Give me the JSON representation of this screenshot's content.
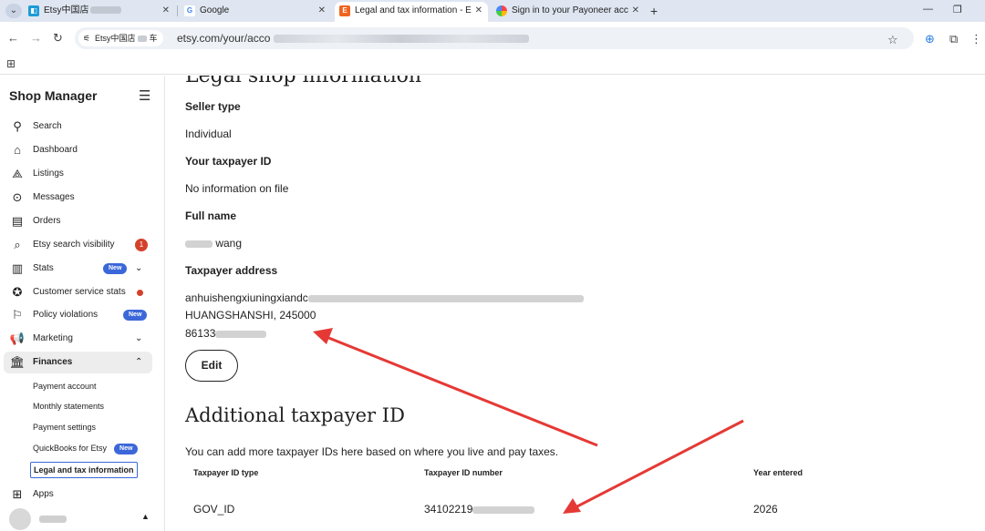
{
  "browser": {
    "tabs": [
      {
        "title": "Etsy中国店",
        "favicon": "etsy-sm-icon",
        "active": false
      },
      {
        "title": "Google",
        "favicon": "google-icon",
        "active": false
      },
      {
        "title": "Legal and tax information - E",
        "favicon": "etsy-icon",
        "active": true
      },
      {
        "title": "Sign in to your Payoneer acc",
        "favicon": "payoneer-icon",
        "active": false
      }
    ],
    "tab_close": "✕",
    "new_tab": "+",
    "site_chip": "Etsy中国店",
    "site_chip_tail": "车",
    "url": "etsy.com/your/acco"
  },
  "sidebar": {
    "title": "Shop Manager",
    "items": [
      {
        "label": "Search",
        "icon": "search-icon"
      },
      {
        "label": "Dashboard",
        "icon": "home-icon"
      },
      {
        "label": "Listings",
        "icon": "listings-icon"
      },
      {
        "label": "Messages",
        "icon": "messages-icon"
      },
      {
        "label": "Orders",
        "icon": "orders-icon"
      },
      {
        "label": "Etsy search visibility",
        "icon": "search-visibility-icon",
        "count": "1"
      },
      {
        "label": "Stats",
        "icon": "stats-icon",
        "badge": "New"
      },
      {
        "label": "Customer service stats",
        "icon": "customer-service-icon"
      },
      {
        "label": "Policy violations",
        "icon": "flag-icon",
        "badge": "New"
      },
      {
        "label": "Marketing",
        "icon": "megaphone-icon"
      },
      {
        "label": "Finances",
        "icon": "bank-icon"
      }
    ],
    "finances_sub": [
      {
        "label": "Payment account"
      },
      {
        "label": "Monthly statements"
      },
      {
        "label": "Payment settings"
      },
      {
        "label": "QuickBooks for Etsy",
        "badge": "New"
      },
      {
        "label": "Legal and tax information"
      }
    ],
    "apps_label": "Apps"
  },
  "legal": {
    "heading": "Legal shop information",
    "seller_type_label": "Seller type",
    "seller_type_value": "Individual",
    "taxpayer_id_label": "Your taxpayer ID",
    "taxpayer_id_value": "No information on file",
    "full_name_label": "Full name",
    "full_name_value": "wang",
    "address_label": "Taxpayer address",
    "address_line1": "anhuishengxiuningxiandc",
    "address_line2": "HUANGSHANSHI, 245000",
    "address_line3": "86133",
    "edit_label": "Edit"
  },
  "additional": {
    "heading": "Additional taxpayer ID",
    "description": "You can add more taxpayer IDs here based on where you live and pay taxes.",
    "columns": [
      "Taxpayer ID type",
      "Taxpayer ID number",
      "Year entered"
    ],
    "rows": [
      {
        "type": "GOV_ID",
        "number": "34102219",
        "year": "2026"
      }
    ]
  },
  "colors": {
    "new_badge": "#3b67d9",
    "alert": "#d4412a",
    "annotation_arrow": "#e53935"
  }
}
